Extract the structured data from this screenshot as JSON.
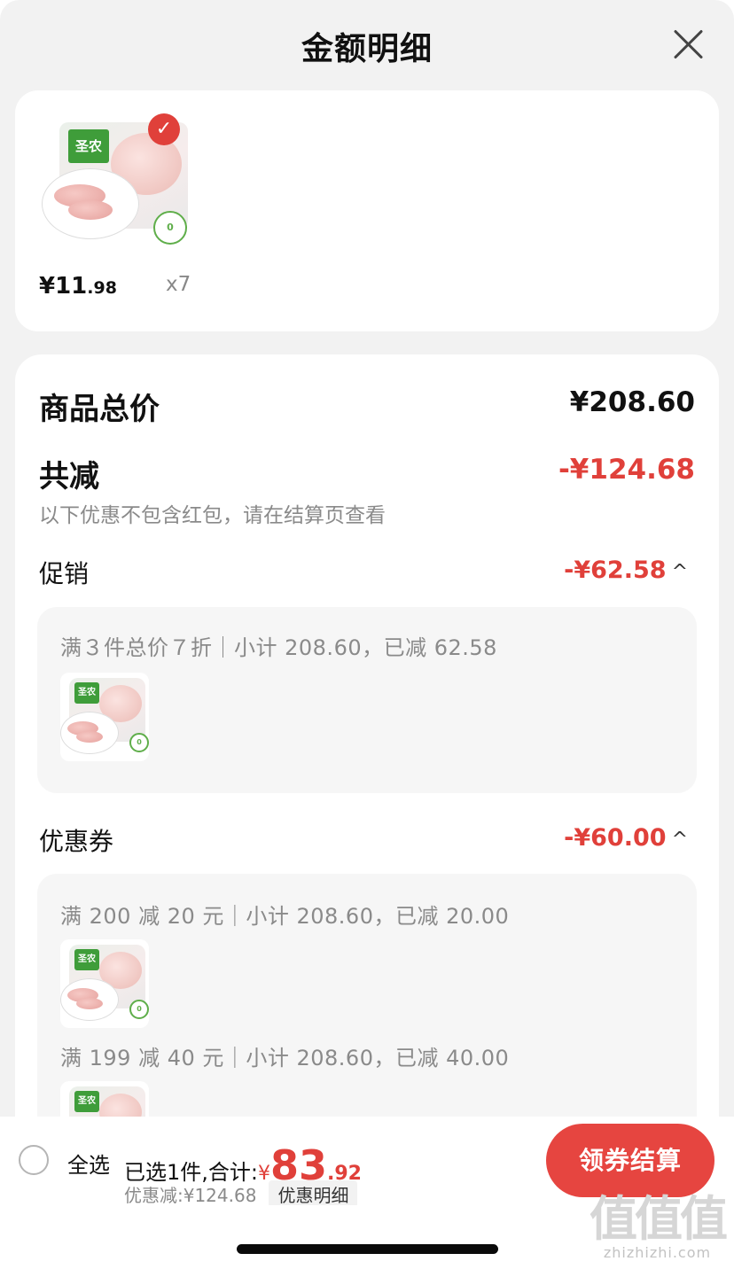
{
  "header": {
    "title": "金额明细"
  },
  "product": {
    "brand": "圣农",
    "price_main": "¥11",
    "price_cents": ".98",
    "quantity": "x7"
  },
  "summary": {
    "total_label": "商品总价",
    "total_value": "¥208.60",
    "reduce_label": "共减",
    "reduce_value": "-¥124.68",
    "reduce_note": "以下优惠不包含红包，请在结算页查看",
    "promo": {
      "label": "促销",
      "value": "-¥62.58",
      "rule": "满３件总价７折｜小计 208.60，已减 62.58"
    },
    "coupon": {
      "label": "优惠券",
      "value": "-¥60.00",
      "rules": [
        "满 200 减 20 元｜小计 208.60，已减 20.00",
        "满 199 减 40 元｜小计 208.60，已减 40.00"
      ]
    }
  },
  "footer": {
    "select_all": "全选",
    "selected_text": "已选1件,合计:",
    "currency": "¥",
    "total_int": "83",
    "total_cents": ".92",
    "discount_text": "优惠减:¥124.68",
    "detail_link": "优惠明细",
    "checkout_label": "领券结算"
  },
  "watermark": {
    "big": "值值值",
    "small": "zhizhizhi.com"
  },
  "colors": {
    "accent": "#e0403a",
    "button": "#e64540",
    "brand_green": "#3f9d3a"
  },
  "icons": {
    "close": "close-icon",
    "check": "check-icon",
    "radio": "radio-unchecked-icon",
    "chevron": "chevron-up-icon"
  }
}
